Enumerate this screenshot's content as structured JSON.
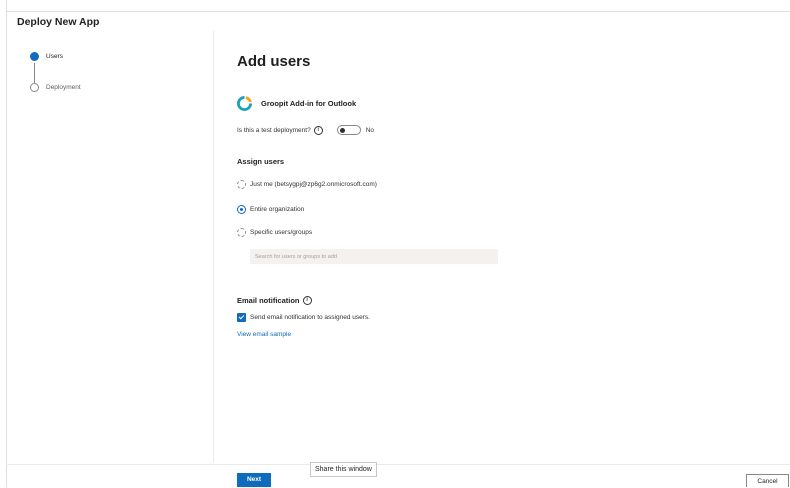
{
  "panel": {
    "title": "Deploy New App"
  },
  "stepper": {
    "steps": [
      {
        "label": "Users",
        "state": "active"
      },
      {
        "label": "Deployment",
        "state": "inactive"
      }
    ]
  },
  "main": {
    "title": "Add users",
    "app": {
      "name": "Groopit Add-in for Outlook",
      "logo_icon": "groopit-logo"
    },
    "test_deployment": {
      "label": "Is this a test deployment?",
      "info_icon": "info-icon",
      "toggle_value": "No",
      "toggle_on": false
    },
    "assign_users": {
      "title": "Assign users",
      "options": [
        {
          "label": "Just me (betsygpj@zp6g2.onmicrosoft.com)",
          "checked": false
        },
        {
          "label": "Entire organization",
          "checked": true
        },
        {
          "label": "Specific users/groups",
          "checked": false
        }
      ],
      "search": {
        "placeholder": "Search for users or groups to add",
        "value": ""
      }
    },
    "email_notification": {
      "title": "Email notification",
      "info_icon": "info-icon",
      "checkbox_label": "Send email notification to assigned users.",
      "checked": true,
      "sample_link": "View email sample"
    }
  },
  "footer": {
    "next_label": "Next",
    "cancel_label": "Cancel",
    "share_label": "Share this window"
  },
  "colors": {
    "accent": "#0f6cbd",
    "text": "#201f1e",
    "muted": "#605e5c",
    "logo_orange": "#f7a21b",
    "logo_teal": "#1aa3b8"
  }
}
